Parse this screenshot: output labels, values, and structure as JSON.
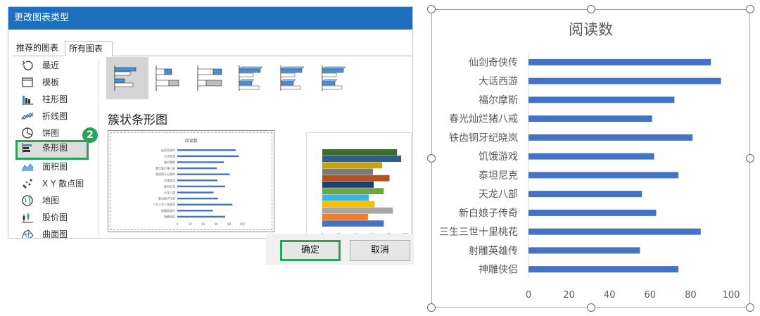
{
  "dialog": {
    "title": "更改图表类型",
    "tabs": [
      {
        "label": "推荐的图表"
      },
      {
        "label": "所有图表"
      }
    ],
    "categories": [
      {
        "label": "最近",
        "icon": "recent-icon"
      },
      {
        "label": "模板",
        "icon": "template-icon"
      },
      {
        "label": "柱形图",
        "icon": "column-chart-icon"
      },
      {
        "label": "折线图",
        "icon": "line-chart-icon"
      },
      {
        "label": "饼图",
        "icon": "pie-chart-icon"
      },
      {
        "label": "条形图",
        "icon": "bar-chart-icon"
      },
      {
        "label": "面积图",
        "icon": "area-chart-icon"
      },
      {
        "label": "X Y 散点图",
        "icon": "scatter-chart-icon"
      },
      {
        "label": "地图",
        "icon": "map-chart-icon"
      },
      {
        "label": "股价图",
        "icon": "stock-chart-icon"
      },
      {
        "label": "曲面图",
        "icon": "surface-chart-icon"
      }
    ],
    "selected_category": "条形图",
    "step_badge": "2",
    "subtype_title": "簇状条形图",
    "ok_label": "确定",
    "cancel_label": "取消",
    "colors": {
      "title_bar": "#1f6fbf",
      "highlight": "#27a35b"
    }
  },
  "chart_data": {
    "type": "bar",
    "orientation": "horizontal",
    "title": "阅读数",
    "categories": [
      "仙剑奇侠传",
      "大话西游",
      "福尔摩斯",
      "春光灿烂猪八戒",
      "铁齿铜牙纪晓岚",
      "饥饿游戏",
      "泰坦尼克",
      "天龙八部",
      "新白娘子传奇",
      "三生三世十里桃花",
      "射雕英雄传",
      "神雕侠侣"
    ],
    "values": [
      90,
      95,
      72,
      61,
      81,
      62,
      74,
      56,
      63,
      85,
      55,
      74
    ],
    "xlim": [
      0,
      100
    ],
    "xticks": [
      "0",
      "20",
      "40",
      "60",
      "80",
      "100"
    ],
    "bar_color": "#4472c4",
    "grid": false,
    "legend": "none"
  }
}
